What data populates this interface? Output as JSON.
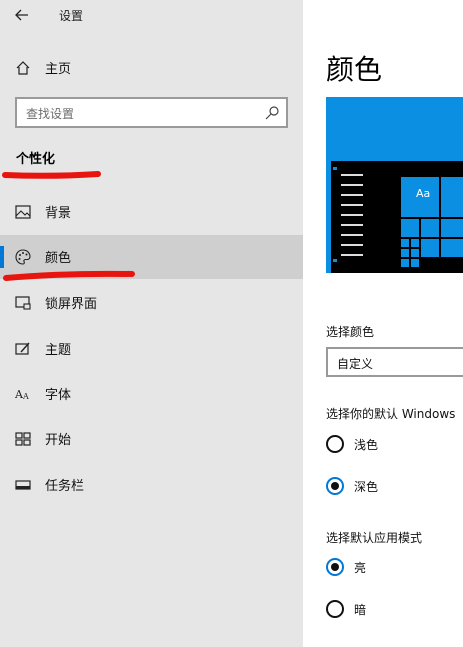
{
  "window": {
    "title": "设置"
  },
  "sidebar": {
    "home_label": "主页",
    "search_placeholder": "查找设置",
    "section_title": "个性化",
    "items": [
      {
        "label": "背景",
        "icon": "picture-icon"
      },
      {
        "label": "颜色",
        "icon": "palette-icon",
        "active": true
      },
      {
        "label": "锁屏界面",
        "icon": "lock-screen-icon"
      },
      {
        "label": "主题",
        "icon": "theme-brush-icon"
      },
      {
        "label": "字体",
        "icon": "font-icon"
      },
      {
        "label": "开始",
        "icon": "start-menu-icon"
      },
      {
        "label": "任务栏",
        "icon": "taskbar-icon"
      }
    ]
  },
  "main": {
    "title": "颜色",
    "preview_tile_text": "Aa",
    "choose_color_label": "选择颜色",
    "choose_color_value": "自定义",
    "windows_mode_label": "选择你的默认 Windows",
    "windows_mode_options": [
      {
        "label": "浅色",
        "checked": false
      },
      {
        "label": "深色",
        "checked": true
      }
    ],
    "app_mode_label": "选择默认应用模式",
    "app_mode_options": [
      {
        "label": "亮",
        "checked": true
      },
      {
        "label": "暗",
        "checked": false
      }
    ]
  },
  "colors": {
    "accent": "#0078d7",
    "preview_blue": "#0a8fe2",
    "annotation_red": "#e8150f"
  }
}
